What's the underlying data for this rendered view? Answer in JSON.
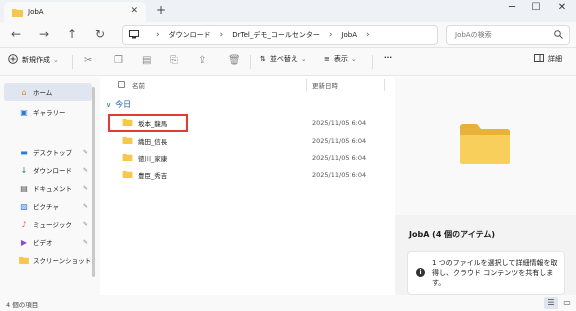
{
  "window": {
    "tab_title": "JobA",
    "tab_close": "✕",
    "new_tab": "+",
    "minimize": "─",
    "maximize": "☐",
    "close": "✕"
  },
  "nav": {
    "back": "←",
    "forward": "→",
    "up": "↑",
    "refresh": "↻"
  },
  "address": {
    "crumbs": [
      "ダウンロード",
      "DrTel_デモ_コールセンター",
      "JobA"
    ],
    "search_placeholder": "JobAの検索"
  },
  "toolbar": {
    "new_label": "新規作成",
    "sort_label": "並べ替え",
    "view_label": "表示",
    "more_label": "···",
    "details_label": "詳細"
  },
  "sidebar": {
    "items": [
      {
        "label": "ホーム",
        "icon": "home-icon"
      },
      {
        "label": "ギャラリー",
        "icon": "gallery-icon"
      },
      {
        "label": "デスクトップ",
        "icon": "desktop-icon"
      },
      {
        "label": "ダウンロード",
        "icon": "download-icon"
      },
      {
        "label": "ドキュメント",
        "icon": "documents-icon"
      },
      {
        "label": "ピクチャ",
        "icon": "pictures-icon"
      },
      {
        "label": "ミュージック",
        "icon": "music-icon"
      },
      {
        "label": "ビデオ",
        "icon": "videos-icon"
      },
      {
        "label": "スクリーンショット",
        "icon": "folder-icon"
      }
    ]
  },
  "list": {
    "col_name": "名前",
    "col_date": "更新日時",
    "group_label": "今日",
    "rows": [
      {
        "name": "坂本_龍馬",
        "date": "2025/11/05 6:04"
      },
      {
        "name": "織田_信長",
        "date": "2025/11/05 6:04"
      },
      {
        "name": "徳川_家康",
        "date": "2025/11/05 6:04"
      },
      {
        "name": "豊臣_秀吉",
        "date": "2025/11/05 6:04"
      }
    ]
  },
  "preview": {
    "title": "JobA (4 個のアイテム)",
    "info_text": "1 つのファイルを選択して詳細情報を取得し、クラウド コンテンツを共有します。"
  },
  "status": {
    "item_count": "4 個の項目"
  },
  "colors": {
    "folder": "#f5c84c",
    "accent": "#1a5fb4",
    "highlight": "#e53935"
  }
}
